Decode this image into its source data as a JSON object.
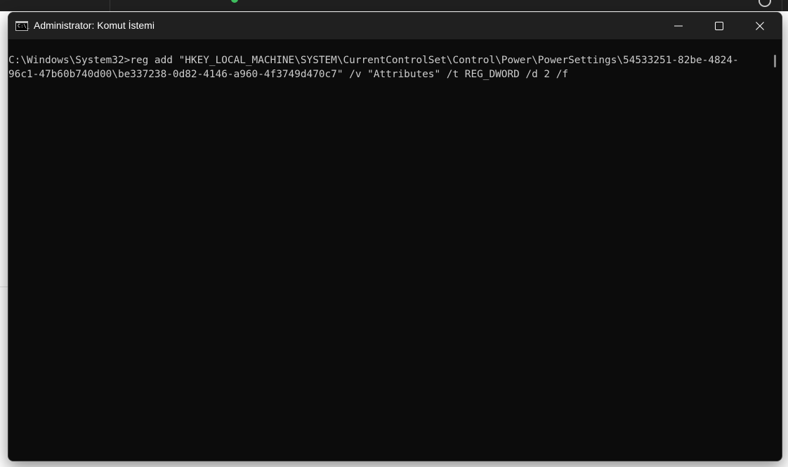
{
  "window": {
    "title": "Administrator: Komut İstemi",
    "icon_glyph": "C:\\_"
  },
  "console": {
    "prompt": "C:\\Windows\\System32>",
    "lines": [
      "C:\\Windows\\System32>reg add \"HKEY_LOCAL_MACHINE\\SYSTEM\\CurrentControlSet\\Control\\Power\\PowerSettings\\54533251-82be-4824-",
      "96c1-47b60b740d00\\be337238-0d82-4146-a960-4f3749d470c7\" /v \"Attributes\" /t REG_DWORD /d 2 /f"
    ]
  },
  "icons": {
    "window_icon": "cmd-icon",
    "minimize": "minimize-icon",
    "maximize": "maximize-icon",
    "close": "close-icon"
  },
  "colors": {
    "console_bg": "#0c0c0c",
    "titlebar_bg": "#202020",
    "console_text": "#cccccc"
  }
}
